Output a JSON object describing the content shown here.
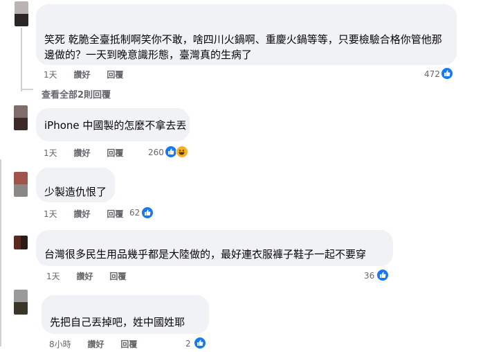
{
  "comments": [
    {
      "text": "笑死 乾脆全臺抵制啊笑你不敢，啥四川火鍋啊、重慶火鍋等等，只要檢驗合格你管他那邊做的？一天到晚意識形態，臺灣真的生病了",
      "time": "1天",
      "like_label": "讚好",
      "reply_label": "回覆",
      "reactions": "472"
    },
    {
      "text": "iPhone 中國製的怎麼不拿去丟",
      "time": "1天",
      "like_label": "讚好",
      "reply_label": "回覆",
      "reactions": "260"
    },
    {
      "text": "少製造仇恨了",
      "time": "1天",
      "like_label": "讚好",
      "reply_label": "回覆",
      "reactions": "62"
    },
    {
      "text": "台灣很多民生用品幾乎都是大陸做的，最好連衣服褲子鞋子一起不要穿",
      "time": "1天",
      "like_label": "讚好",
      "reply_label": "回覆",
      "reactions": "36"
    },
    {
      "text": "先把自己丟掉吧，姓中國姓耶",
      "time": "8小時",
      "like_label": "讚好",
      "reply_label": "回覆",
      "reactions": "2"
    }
  ],
  "view_replies": "查看全部2則回覆",
  "colors": {
    "bubble": "#f0f2f5",
    "like_blue": "#1877f2",
    "meta_gray": "#65676b",
    "thread_line": "#ced0d4"
  },
  "icons": [
    "like-icon",
    "haha-icon"
  ]
}
